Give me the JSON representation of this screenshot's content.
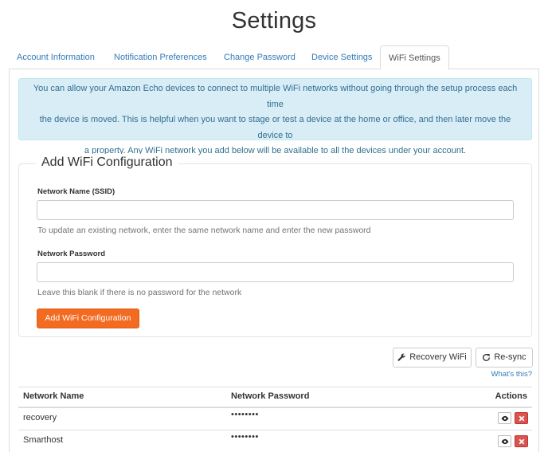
{
  "page": {
    "title": "Settings"
  },
  "tabs": [
    {
      "label": "Account Information"
    },
    {
      "label": "Notification Preferences"
    },
    {
      "label": "Change Password"
    },
    {
      "label": "Device Settings"
    },
    {
      "label": "WiFi Settings",
      "active": true
    }
  ],
  "info": {
    "line1": "You can allow your Amazon Echo devices to connect to multiple WiFi networks without going through the setup process each time",
    "line2": "the device is moved. This is helpful when you want to stage or test a device at the home or office, and then later move the device to",
    "line3": "a property. Any WiFi network you add below will be available to all the devices under your account."
  },
  "form": {
    "legend": "Add WiFi Configuration",
    "ssid_label": "Network Name (SSID)",
    "ssid_value": "",
    "ssid_help": "To update an existing network, enter the same network name and enter the new password",
    "password_label": "Network Password",
    "password_value": "",
    "password_help": "Leave this blank if there is no password for the network",
    "submit_label": "Add WiFi Configuration"
  },
  "actions": {
    "recovery_label": "Recovery WiFi",
    "resync_label": "Re-sync",
    "whats_this": "What's this?"
  },
  "table": {
    "headers": {
      "name": "Network Name",
      "password": "Network Password",
      "actions": "Actions"
    },
    "rows": [
      {
        "name": "recovery",
        "password": "••••••••"
      },
      {
        "name": "Smarthost",
        "password": "••••••••"
      }
    ]
  },
  "colors": {
    "accent": "#f26b21",
    "link": "#337ab7",
    "info_bg": "#d9edf7",
    "info_text": "#31708f",
    "danger": "#d9534f"
  },
  "icons": {
    "recovery": "wrench-icon",
    "resync": "refresh-icon",
    "view": "eye-icon",
    "delete": "close-icon"
  }
}
